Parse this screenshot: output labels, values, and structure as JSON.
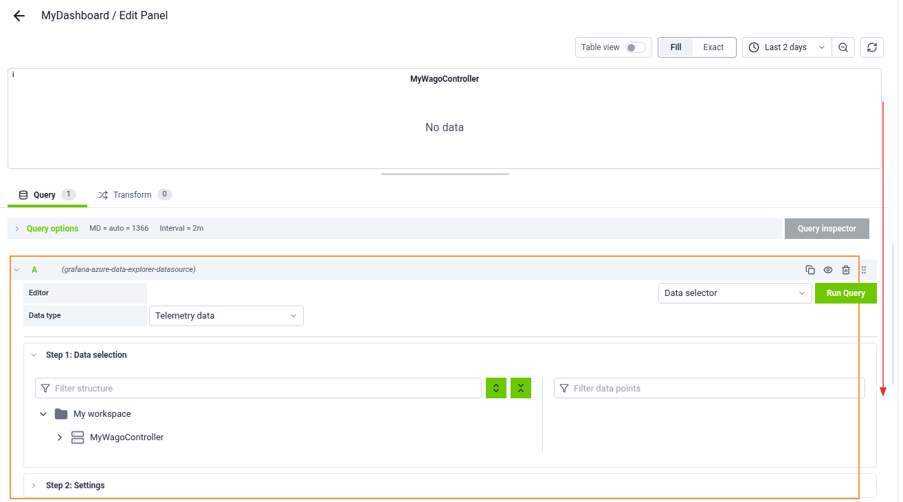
{
  "header": {
    "title": "MyDashboard / Edit Panel"
  },
  "toolbar": {
    "table_view": {
      "label": "Table view",
      "on": false
    },
    "fit": [
      {
        "label": "Fill",
        "selected": true
      },
      {
        "label": "Exact",
        "selected": false
      }
    ],
    "time_range": "Last 2 days"
  },
  "panel": {
    "info": "i",
    "title": "MyWagoController",
    "message": "No data"
  },
  "tabs": [
    {
      "label": "Query",
      "count": "1",
      "selected": true,
      "kind": "query"
    },
    {
      "label": "Transform",
      "count": "0",
      "selected": false,
      "kind": "transform"
    }
  ],
  "query_options": {
    "label": "Query options",
    "expanded": false,
    "details": [
      "MD = auto = 1366",
      "Interval = 2m"
    ],
    "inspector": "Query inspector"
  },
  "query": {
    "ref": "A",
    "expanded": true,
    "datasource": "(grafana-azure-data-explorer-datasource)",
    "editor_label": "Editor",
    "editor_mode": "Data selector",
    "run": "Run Query",
    "data_type_label": "Data type",
    "data_type": "Telemetry data",
    "steps": [
      {
        "title": "Step 1: Data selection",
        "expanded": true,
        "filter_placeholder": "Filter structure",
        "points_placeholder": "Filter data points",
        "tree": [
          {
            "label": "My workspace",
            "kind": "workspace",
            "expanded": true,
            "children": [
              {
                "label": "MyWagoController",
                "kind": "device",
                "expanded": false
              }
            ]
          }
        ]
      },
      {
        "title": "Step 2: Settings",
        "expanded": false
      }
    ]
  }
}
